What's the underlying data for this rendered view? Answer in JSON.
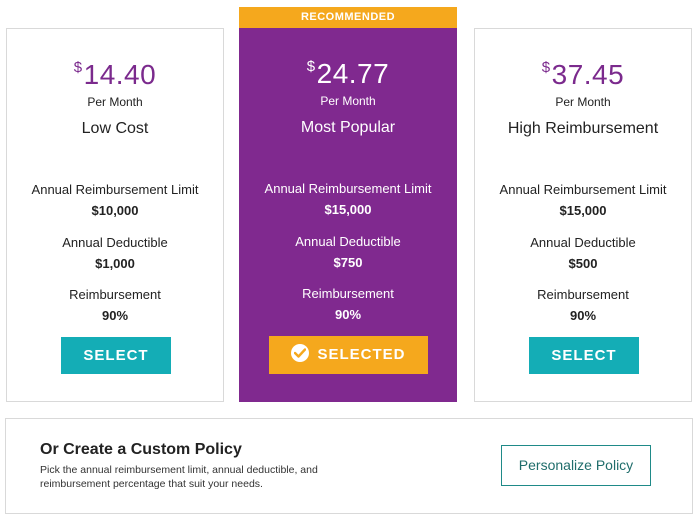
{
  "plans": [
    {
      "currency": "$",
      "price": "14.40",
      "period": "Per Month",
      "name": "Low Cost",
      "limit_label": "Annual Reimbursement Limit",
      "limit_value": "$10,000",
      "deductible_label": "Annual Deductible",
      "deductible_value": "$1,000",
      "reimb_label": "Reimbursement",
      "reimb_value": "90%",
      "button": "SELECT"
    },
    {
      "badge": "RECOMMENDED",
      "currency": "$",
      "price": "24.77",
      "period": "Per Month",
      "name": "Most Popular",
      "limit_label": "Annual Reimbursement Limit",
      "limit_value": "$15,000",
      "deductible_label": "Annual Deductible",
      "deductible_value": "$750",
      "reimb_label": "Reimbursement",
      "reimb_value": "90%",
      "button": "SELECTED"
    },
    {
      "currency": "$",
      "price": "37.45",
      "period": "Per Month",
      "name": "High Reimbursement",
      "limit_label": "Annual Reimbursement Limit",
      "limit_value": "$15,000",
      "deductible_label": "Annual Deductible",
      "deductible_value": "$500",
      "reimb_label": "Reimbursement",
      "reimb_value": "90%",
      "button": "SELECT"
    }
  ],
  "custom": {
    "title": "Or Create a Custom Policy",
    "description": "Pick the annual reimbursement limit, annual deductible, and reimbursement percentage that suit your needs.",
    "button": "Personalize Policy"
  },
  "colors": {
    "brand_purple": "#80298f",
    "accent_orange": "#f5a81d",
    "teal": "#14adb6"
  }
}
